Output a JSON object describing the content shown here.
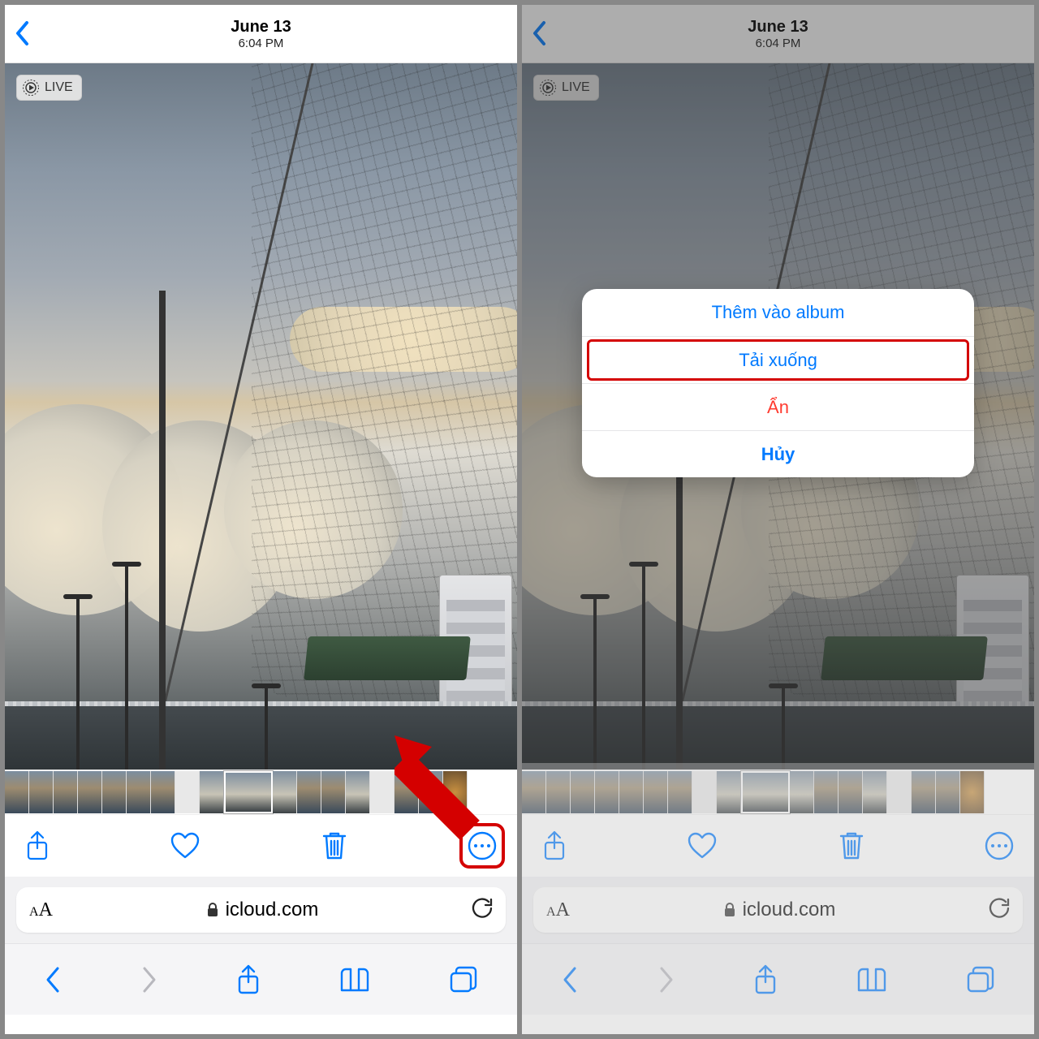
{
  "header": {
    "date": "June 13",
    "time": "6:04 PM"
  },
  "live_badge": "LIVE",
  "url": {
    "domain": "icloud.com"
  },
  "action_sheet": {
    "add_to_album": "Thêm vào album",
    "download": "Tải xuống",
    "hide": "Ẩn",
    "cancel": "Hủy"
  }
}
